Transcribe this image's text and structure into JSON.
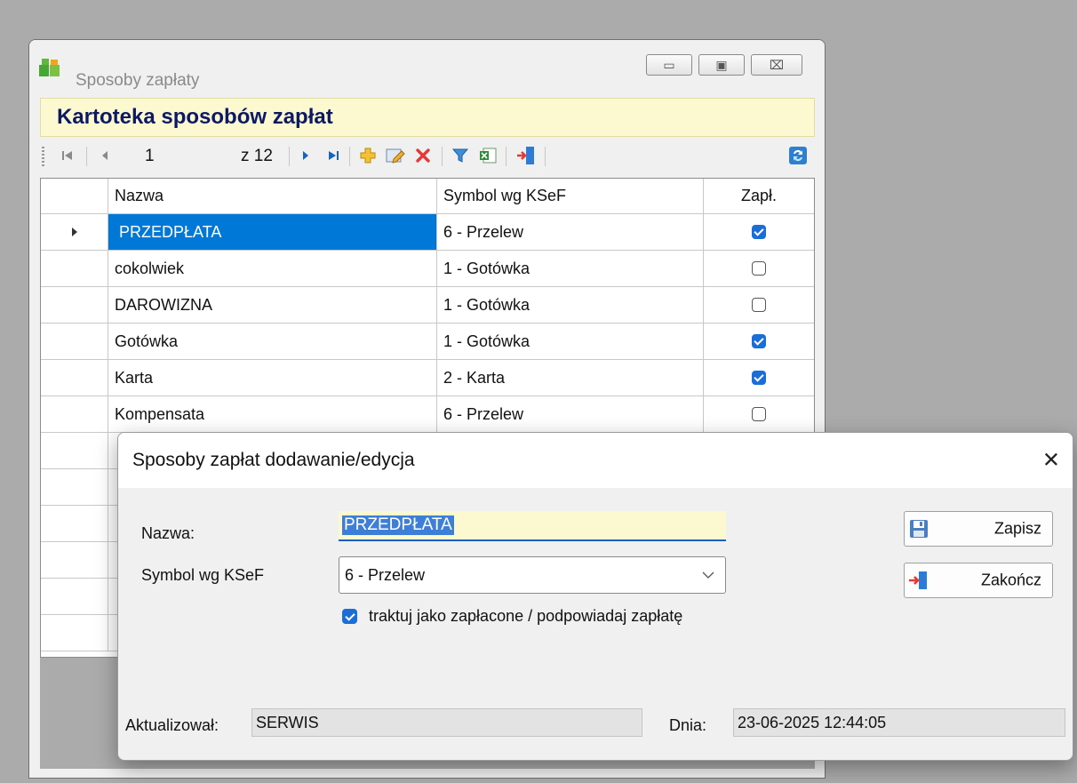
{
  "window": {
    "title": "Sposoby zapłaty",
    "header": "Kartoteka sposobów zapłat",
    "caption_buttons": {
      "minimize": "▭",
      "maximize": "▣",
      "close": "⌧"
    }
  },
  "toolbar": {
    "position": "1",
    "page_of": "z 12",
    "icons": [
      "first-icon",
      "prev-icon",
      "next-icon",
      "last-icon",
      "add-icon",
      "edit-icon",
      "delete-icon",
      "filter-icon",
      "excel-icon",
      "exit-icon",
      "refresh-icon"
    ]
  },
  "grid": {
    "columns": [
      "Nazwa",
      "Symbol wg KSeF",
      "Zapł."
    ],
    "rows": [
      {
        "nazwa": "PRZEDPŁATA",
        "symbol": "6 - Przelew",
        "paid": true,
        "selected": true
      },
      {
        "nazwa": "cokolwiek",
        "symbol": "1 - Gotówka",
        "paid": false
      },
      {
        "nazwa": "DAROWIZNA",
        "symbol": "1 - Gotówka",
        "paid": false
      },
      {
        "nazwa": "Gotówka",
        "symbol": "1 - Gotówka",
        "paid": true
      },
      {
        "nazwa": "Karta",
        "symbol": "2 - Karta",
        "paid": true
      },
      {
        "nazwa": "Kompensata",
        "symbol": "6 - Przelew",
        "paid": false
      }
    ],
    "hidden_rows": 6
  },
  "dialog": {
    "title": "Sposoby zapłat dodawanie/edycja",
    "close_glyph": "✕",
    "name_label": "Nazwa:",
    "name_value": "PRZEDPŁATA",
    "symbol_label": "Symbol wg KSeF",
    "symbol_value": "6 - Przelew",
    "checkbox_label": "traktuj jako zapłacone / podpowiadaj zapłatę",
    "checkbox_checked": true,
    "save_label": "Zapisz",
    "close_label": "Zakończ",
    "updated_by_label": "Aktualizował:",
    "updated_by_value": "SERWIS",
    "date_label": "Dnia:",
    "date_value": "23-06-2025 12:44:05"
  },
  "colors": {
    "accent": "#0078d7",
    "header_bg": "#fcf9d0",
    "header_text": "#0d1a63",
    "desktop": "#ababab"
  }
}
